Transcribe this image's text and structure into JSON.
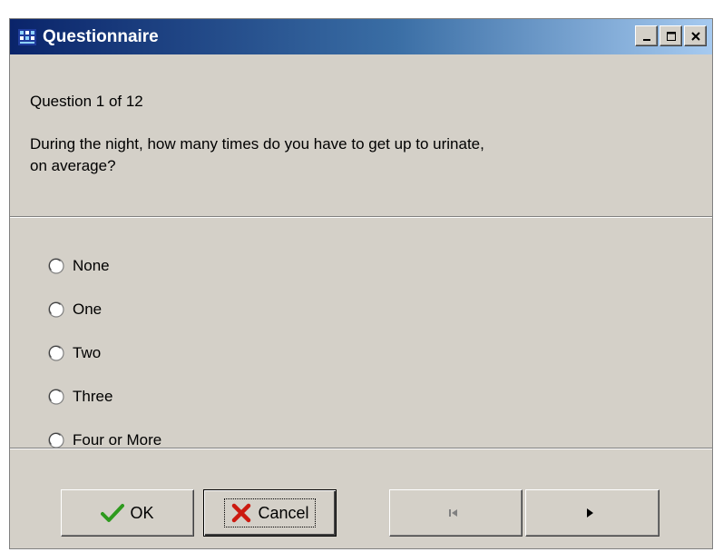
{
  "window": {
    "title": "Questionnaire",
    "controls": [
      "minimize-icon",
      "maximize-icon",
      "close-icon"
    ]
  },
  "question": {
    "counter": "Question 1 of 12",
    "text_line1": "During the night, how many times do you have to get up to urinate,",
    "text_line2": "on average?"
  },
  "options": [
    {
      "label": "None",
      "selected": false
    },
    {
      "label": "One",
      "selected": false
    },
    {
      "label": "Two",
      "selected": false
    },
    {
      "label": "Three",
      "selected": false
    },
    {
      "label": "Four or More",
      "selected": false
    }
  ],
  "buttons": {
    "ok_label": "OK",
    "cancel_label": "Cancel",
    "ok_icon": "check-icon",
    "cancel_icon": "x-icon",
    "prev_icon": "prev-arrow-icon",
    "next_icon": "next-arrow-icon"
  },
  "colors": {
    "title_start": "#0a246a",
    "title_end": "#a6caf0",
    "face": "#d4d0c8",
    "check": "#2e9a1e",
    "cancel_x": "#cc1a10",
    "disabled": "#808080"
  }
}
